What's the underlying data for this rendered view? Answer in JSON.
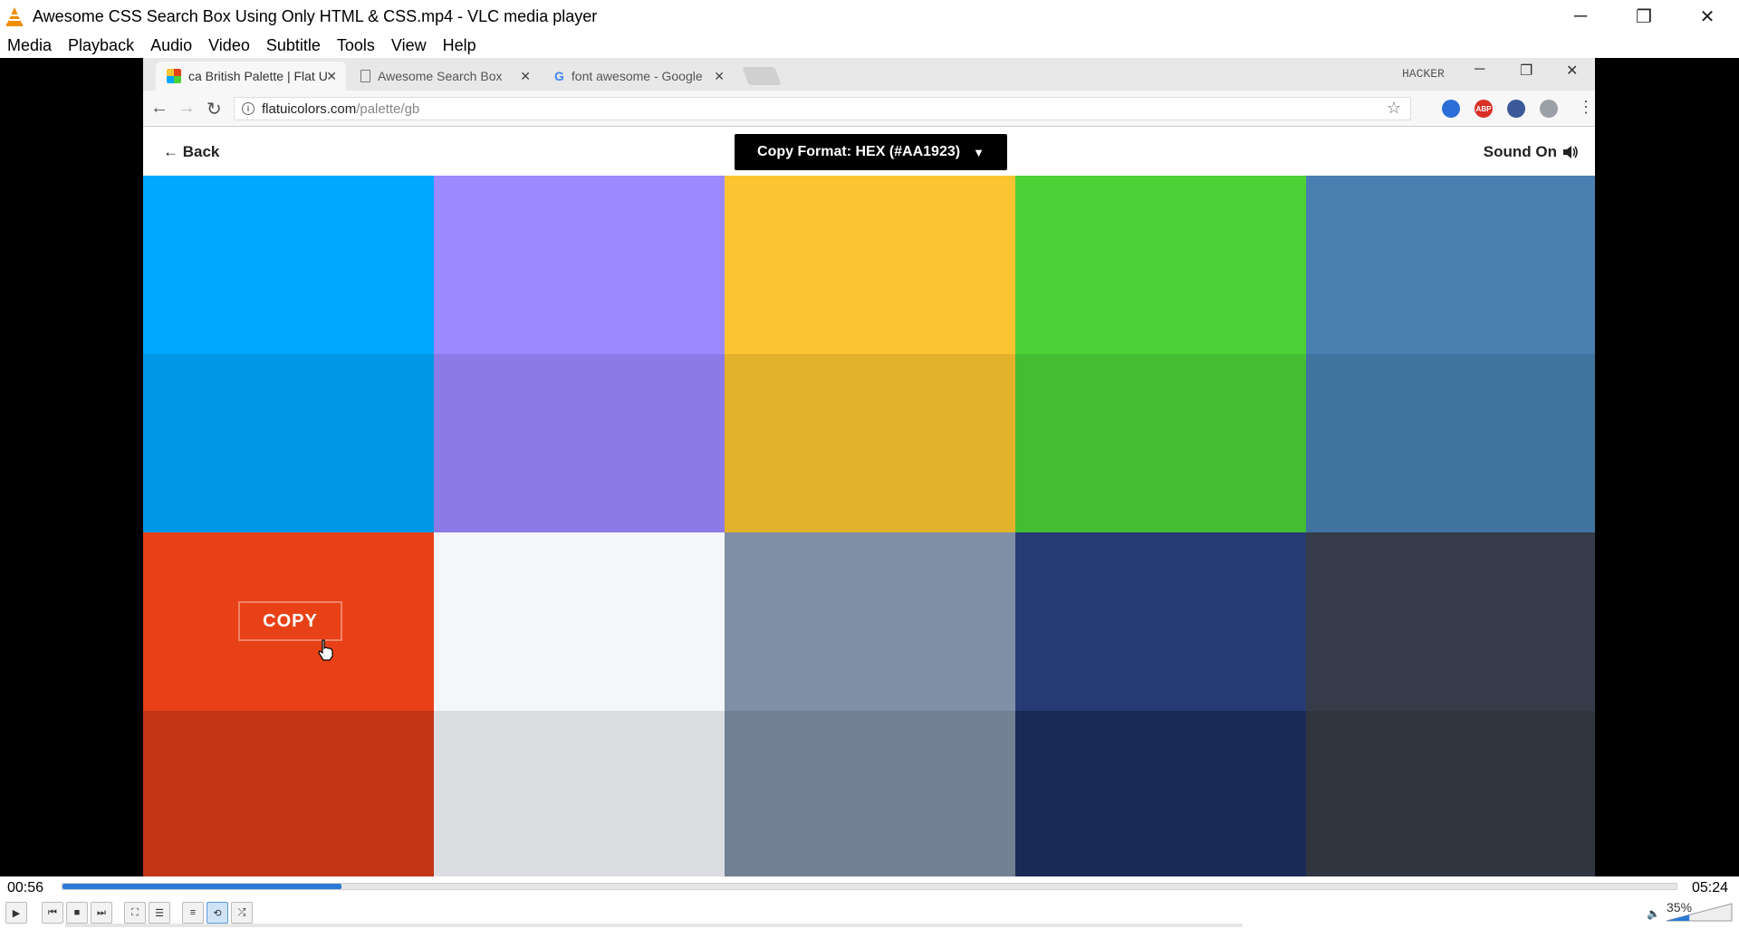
{
  "window": {
    "title": "Awesome CSS Search Box Using Only HTML & CSS.mp4 - VLC media player",
    "minimize_glyph": "─",
    "restore_glyph": "❐",
    "close_glyph": "✕"
  },
  "menu": [
    "Media",
    "Playback",
    "Audio",
    "Video",
    "Subtitle",
    "Tools",
    "View",
    "Help"
  ],
  "browser": {
    "tabs": [
      {
        "label": "ca British Palette | Flat U",
        "active": true
      },
      {
        "label": "Awesome Search Box",
        "active": false
      },
      {
        "label": "font awesome - Google",
        "active": false
      }
    ],
    "user_label": "HACKER",
    "url_host": "flatuicolors.com",
    "url_path": "/palette/gb",
    "extensions": [
      "ext-1",
      "ABP",
      "ext-3",
      "ext-4"
    ],
    "ext_colors": [
      "#2b6ed8",
      "#d93025",
      "#3b5998",
      "#9aa0a6"
    ]
  },
  "page": {
    "back_label": "Back",
    "copy_format_label": "Copy Format: HEX (#AA1923)",
    "sound_label": "Sound On",
    "copy_button_label": "COPY"
  },
  "palette": {
    "rows": [
      [
        "#00a8ff",
        "#9c88ff",
        "#fbc531",
        "#4cd137",
        "#487eb0"
      ],
      [
        "#0097e6",
        "#8c7ae6",
        "#e1b12c",
        "#44bd32",
        "#40739e"
      ],
      [
        "#e84118",
        "#f5f6fa",
        "#7f8fa6",
        "#273c75",
        "#353b48"
      ],
      [
        "#c23616",
        "#dcdde1",
        "#718093",
        "#192a56",
        "#2f3640"
      ]
    ],
    "copy_swatch": {
      "row": 2,
      "col": 0
    }
  },
  "player": {
    "elapsed": "00:56",
    "total": "05:24",
    "progress": 0.173,
    "volume": "35%",
    "volume_level": 0.35
  }
}
